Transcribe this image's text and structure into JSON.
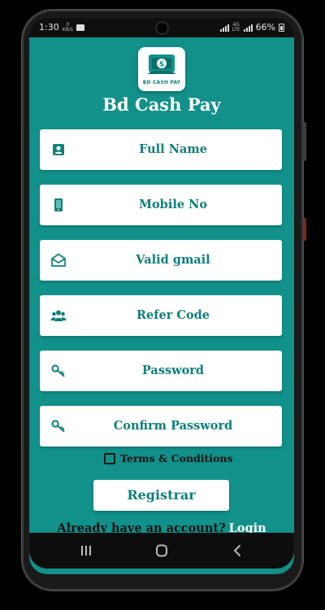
{
  "status_bar": {
    "time": "1:30",
    "mini_top": "0",
    "mini_bottom": "KB/s",
    "network_top": "4G",
    "network_bottom": "LTE",
    "battery": "66%"
  },
  "app": {
    "logo_text": "BD CASH PAY",
    "logo_symbol": "$",
    "title": "Bd Cash Pay"
  },
  "form": {
    "fields": [
      {
        "label": "Full Name",
        "icon": "person-card-icon"
      },
      {
        "label": "Mobile No",
        "icon": "mobile-phone-icon"
      },
      {
        "label": "Valid gmail",
        "icon": "envelope-open-icon"
      },
      {
        "label": "Refer Code",
        "icon": "users-group-icon"
      },
      {
        "label": "Password",
        "icon": "key-icon"
      },
      {
        "label": "Confirm Password",
        "icon": "key-icon"
      }
    ],
    "terms_label": "Terms & Conditions",
    "terms_checked": false,
    "submit_label": "Registrar",
    "account_question": "Already have an account?",
    "login_label": "Login"
  },
  "nav": {
    "recents": "recents-icon",
    "home": "home-icon",
    "back": "back-icon"
  },
  "colors": {
    "primary": "#12908a",
    "accent_text": "#0e7f7a",
    "field_bg": "#ffffff",
    "dark_text": "#111111"
  }
}
